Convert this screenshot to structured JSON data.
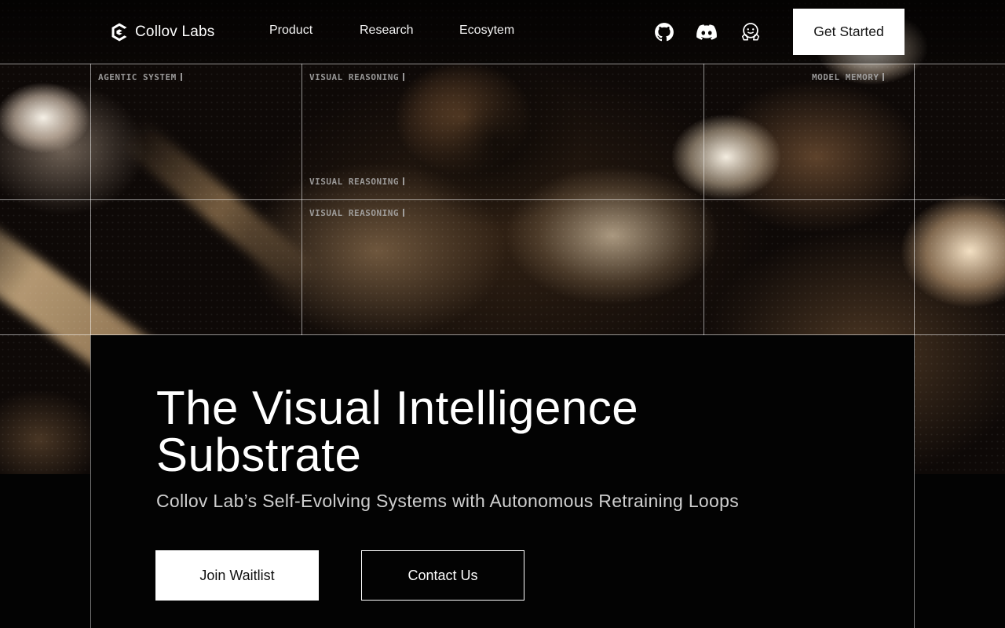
{
  "brand": {
    "name": "Collov Labs",
    "logo_icon": "collov-hexagon-c-icon"
  },
  "nav": {
    "items": [
      {
        "label": "Product"
      },
      {
        "label": "Research"
      },
      {
        "label": "Ecosytem"
      }
    ],
    "social": [
      {
        "icon": "github-icon"
      },
      {
        "icon": "discord-icon"
      },
      {
        "icon": "huggingface-icon"
      }
    ],
    "cta_label": "Get Started"
  },
  "grid_labels": {
    "cell_1": "AGENTIC SYSTEM",
    "cell_2": "VISUAL REASONING",
    "cell_3": "VISUAL REASONING",
    "cell_4": "VISUAL REASONING",
    "cell_5": "MODEL MEMORY"
  },
  "hero": {
    "headline_line1": "The Visual Intelligence",
    "headline_line2": "Substrate",
    "subheadline": "Collov Lab’s Self-Evolving Systems with Autonomous Retraining Loops",
    "primary_button": "Join Waitlist",
    "secondary_button": "Contact Us"
  },
  "colors": {
    "background": "#030303",
    "text": "#ffffff",
    "subtext": "#cfcfcf",
    "button_fill": "#ffffff",
    "button_text": "#111111"
  }
}
